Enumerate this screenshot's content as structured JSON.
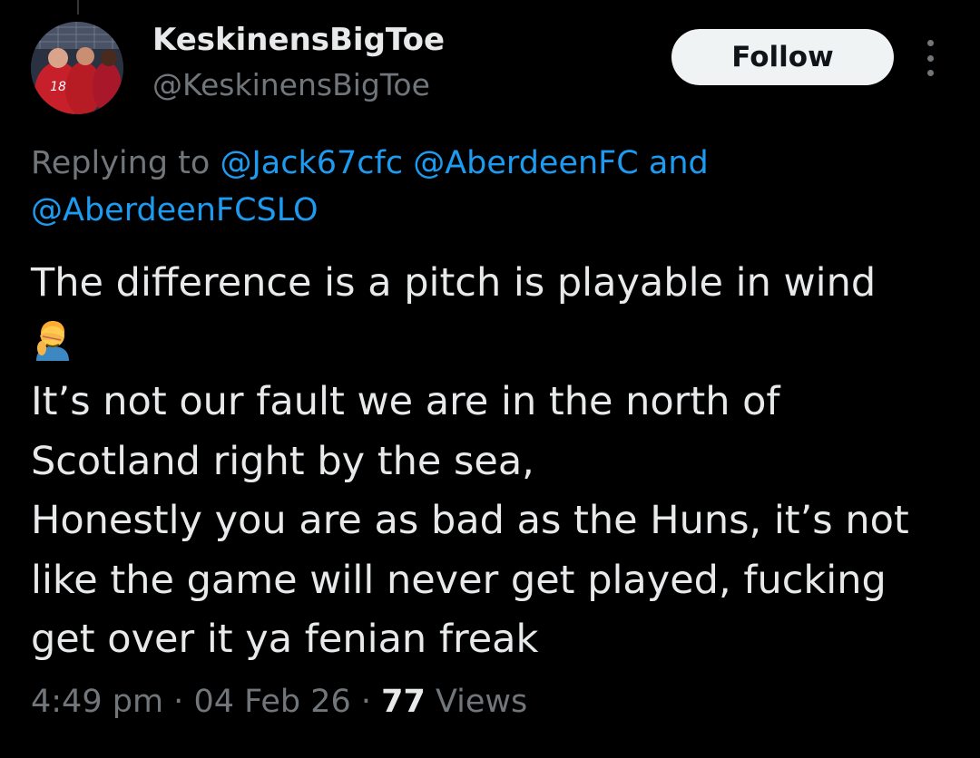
{
  "author": {
    "display_name": "KeskinensBigToe",
    "handle": "@KeskinensBigToe",
    "avatar_icon": "football-players-photo"
  },
  "follow_label": "Follow",
  "more_icon": "more-vertical-icon",
  "reply": {
    "prefix": "Replying to ",
    "mention_1": "@Jack67cfc",
    "mention_2": "@AberdeenFC",
    "joiner": " and",
    "mention_3": "@AberdeenFCSLO"
  },
  "tweet": {
    "line_1": "The difference is a pitch is playable in wind",
    "emoji": "person-facepalming-icon",
    "line_2": "It’s not our fault we are in the north of",
    "line_3": "Scotland right by the sea,",
    "line_4": "Honestly you are as bad as the Huns, it’s not",
    "line_5": "like the game will never get played, fucking",
    "line_6": "get over it ya fenian freak"
  },
  "meta": {
    "time": "4:49 pm",
    "separator": " · ",
    "date": "04 Feb 26",
    "views_count": "77",
    "views_label": " Views"
  },
  "colors": {
    "background": "#000000",
    "text": "#e7e9ea",
    "muted": "#71767b",
    "link": "#1d9bf0",
    "follow_bg": "#eff3f4"
  }
}
